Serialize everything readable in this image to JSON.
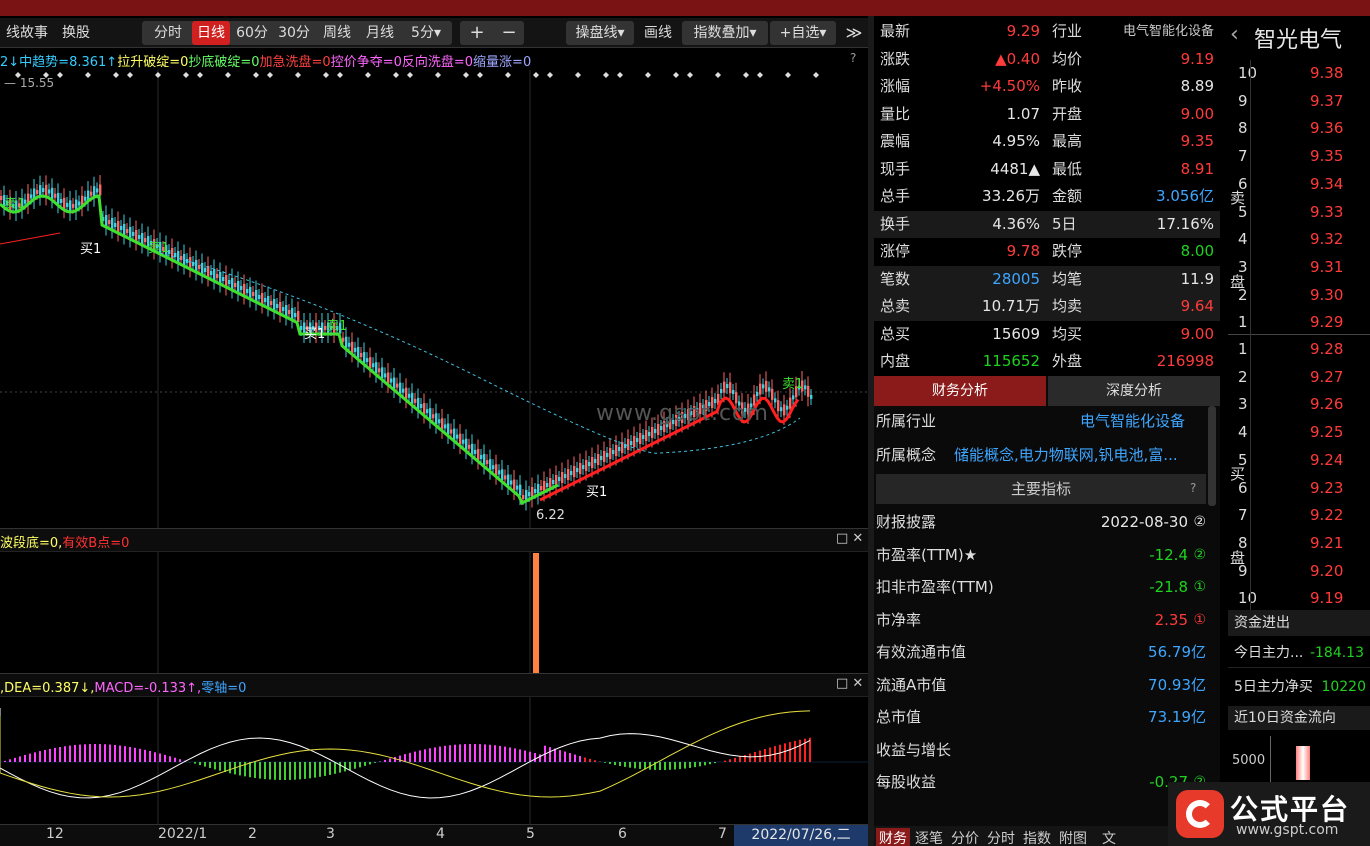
{
  "toolbar": {
    "left_tabs": [
      "线故事",
      "换股"
    ],
    "periods": [
      "分时",
      "日线",
      "60分",
      "30分",
      "周线",
      "月线",
      "5分▾"
    ],
    "active_period": "日线",
    "zoom_in": "+",
    "zoom_out": "−",
    "tools": [
      "操盘线▾",
      "画线",
      "指数叠加▾",
      "+自选▾"
    ],
    "collapse": "≫"
  },
  "indicators": {
    "main_legend": [
      {
        "text": "2↓",
        "color": "#33ccff"
      },
      {
        "text": "中趋势=8.361↑",
        "color": "#33ccff"
      },
      {
        "text": "拉升破绽=0",
        "color": "#ffff66"
      },
      {
        "text": "抄底破绽=0",
        "color": "#66ff66"
      },
      {
        "text": "加急洗盘=0",
        "color": "#ff4040"
      },
      {
        "text": "控价争夺=0",
        "color": "#ff66ff"
      },
      {
        "text": "反向洗盘=0",
        "color": "#ff66ff"
      },
      {
        "text": "缩量涨=0",
        "color": "#9fa8ff"
      }
    ],
    "main_help": "?",
    "price_high": "15.55",
    "price_low": "6.22",
    "watermark": "www.gspt.com",
    "buy_label": "买1",
    "sell_label": "卖1",
    "sub1_legend": [
      {
        "text": "波段底=0,",
        "color": "#ffff66"
      },
      {
        "text": "有效B点=0",
        "color": "#ff3030"
      }
    ],
    "sub2_legend": [
      {
        "text": ",DEA=0.387↓,",
        "color": "#ffff66"
      },
      {
        "text": "MACD=-0.133↑,",
        "color": "#ff66ff"
      },
      {
        "text": "零轴=0",
        "color": "#3ea6ff"
      }
    ],
    "window_buttons": "□ ✕"
  },
  "timeline": {
    "labels": [
      "12",
      "2022/1",
      "2",
      "3",
      "4",
      "5",
      "6",
      "7"
    ],
    "cursor_date": "2022/07/26,二"
  },
  "quote": {
    "rows": [
      {
        "l1": "最新",
        "v1": "9.29",
        "c1": "red",
        "l2": "行业",
        "v2": "电气智能化设备",
        "c2": "gray"
      },
      {
        "l1": "涨跌",
        "v1": "▲0.40",
        "c1": "red",
        "l2": "均价",
        "v2": "9.19",
        "c2": "red"
      },
      {
        "l1": "涨幅",
        "v1": "+4.50%",
        "c1": "red",
        "l2": "昨收",
        "v2": "8.89",
        "c2": "white"
      },
      {
        "l1": "量比",
        "v1": "1.07",
        "c1": "white",
        "l2": "开盘",
        "v2": "9.00",
        "c2": "red"
      },
      {
        "l1": "震幅",
        "v1": "4.95%",
        "c1": "white",
        "l2": "最高",
        "v2": "9.35",
        "c2": "red"
      },
      {
        "l1": "现手",
        "v1": "4481▲",
        "c1": "white",
        "l2": "最低",
        "v2": "8.91",
        "c2": "red"
      },
      {
        "l1": "总手",
        "v1": "33.26万",
        "c1": "white",
        "l2": "金额",
        "v2": "3.056亿",
        "c2": "blue"
      },
      {
        "l1": "换手",
        "v1": "4.36%",
        "c1": "white",
        "l2": "5日",
        "v2": "17.16%",
        "c2": "white"
      },
      {
        "l1": "涨停",
        "v1": "9.78",
        "c1": "red",
        "l2": "跌停",
        "v2": "8.00",
        "c2": "green"
      },
      {
        "l1": "笔数",
        "v1": "28005",
        "c1": "blue",
        "l2": "均笔",
        "v2": "11.9",
        "c2": "white"
      },
      {
        "l1": "总卖",
        "v1": "10.71万",
        "c1": "white",
        "l2": "均卖",
        "v2": "9.64",
        "c2": "red"
      },
      {
        "l1": "总买",
        "v1": "15609",
        "c1": "white",
        "l2": "均买",
        "v2": "9.00",
        "c2": "red"
      },
      {
        "l1": "内盘",
        "v1": "115652",
        "c1": "green",
        "l2": "外盘",
        "v2": "216998",
        "c2": "red"
      }
    ]
  },
  "finance": {
    "tabs": [
      "财务分析",
      "深度分析"
    ],
    "industry_label": "所属行业",
    "industry_value": "电气智能化设备",
    "concept_label": "所属概念",
    "concept_value": "储能概念,电力物联网,钒电池,富...",
    "section_title": "主要指标",
    "section_help": "?",
    "rows": [
      {
        "label": "财报披露",
        "value": "2022-08-30",
        "badge": "②",
        "color": "white"
      },
      {
        "label": "市盈率(TTM)★",
        "value": "-12.4",
        "badge": "②",
        "color": "green"
      },
      {
        "label": "扣非市盈率(TTM)",
        "value": "-21.8",
        "badge": "①",
        "color": "green"
      },
      {
        "label": "市净率",
        "value": "2.35",
        "badge": "①",
        "color": "red"
      },
      {
        "label": "有效流通市值",
        "value": "56.79亿",
        "badge": "",
        "color": "blue"
      },
      {
        "label": "流通A市值",
        "value": "70.93亿",
        "badge": "",
        "color": "blue"
      },
      {
        "label": "总市值",
        "value": "73.19亿",
        "badge": "",
        "color": "blue"
      },
      {
        "label": "收益与增长",
        "value": "",
        "badge": "",
        "color": "white"
      },
      {
        "label": "每股收益",
        "value": "-0.27",
        "badge": "②",
        "color": "green"
      }
    ],
    "bottom_tabs": [
      "财务",
      "逐笔",
      "分价",
      "分时",
      "指数",
      "附图",
      "文"
    ]
  },
  "book": {
    "stock_name": "智光电气",
    "back": "‹",
    "sell_label": "卖盘",
    "buy_label": "买盘",
    "sell": [
      {
        "lvl": "10",
        "price": "9.38"
      },
      {
        "lvl": "9",
        "price": "9.37"
      },
      {
        "lvl": "8",
        "price": "9.36"
      },
      {
        "lvl": "7",
        "price": "9.35"
      },
      {
        "lvl": "6",
        "price": "9.34"
      },
      {
        "lvl": "5",
        "price": "9.33"
      },
      {
        "lvl": "4",
        "price": "9.32"
      },
      {
        "lvl": "3",
        "price": "9.31"
      },
      {
        "lvl": "2",
        "price": "9.30"
      },
      {
        "lvl": "1",
        "price": "9.29"
      }
    ],
    "buy": [
      {
        "lvl": "1",
        "price": "9.28"
      },
      {
        "lvl": "2",
        "price": "9.27"
      },
      {
        "lvl": "3",
        "price": "9.26"
      },
      {
        "lvl": "4",
        "price": "9.25"
      },
      {
        "lvl": "5",
        "price": "9.24"
      },
      {
        "lvl": "6",
        "price": "9.23"
      },
      {
        "lvl": "7",
        "price": "9.22"
      },
      {
        "lvl": "8",
        "price": "9.21"
      },
      {
        "lvl": "9",
        "price": "9.20"
      },
      {
        "lvl": "10",
        "price": "9.19"
      }
    ],
    "fund_title": "资金进出",
    "today_main_label": "今日主力...",
    "today_main_value": "-184.13",
    "five_day_label": "5日主力净买",
    "five_day_value": "10220",
    "ten_day_title": "近10日资金流向",
    "ten_day_axis": "5000"
  },
  "logo": {
    "name": "公式平台",
    "url": "www.gspt.com"
  }
}
